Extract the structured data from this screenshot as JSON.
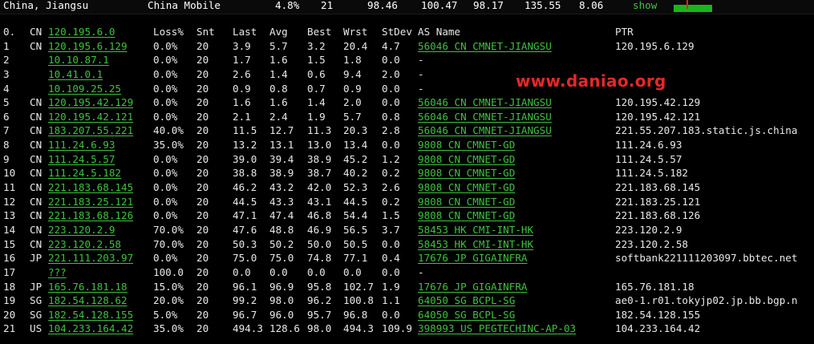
{
  "summary": {
    "location": "China, Jiangsu",
    "isp": "China Mobile",
    "loss": "4.8%",
    "snt": "21",
    "v1": "98.46",
    "v2": "100.47",
    "v3": "98.17",
    "v4": "135.55",
    "v5": "8.06",
    "show_label": "show"
  },
  "watermark": "www.daniao.org",
  "header": {
    "idx": "0.",
    "cc": "CN",
    "ip": "120.195.6.0",
    "loss": "Loss%",
    "snt": "Snt",
    "last": "Last",
    "avg": "Avg",
    "best": "Best",
    "wrst": "Wrst",
    "stdev": "StDev",
    "as": "AS Name",
    "ptr": "PTR"
  },
  "hops": [
    {
      "idx": "1",
      "cc": "CN",
      "ip": "120.195.6.129",
      "loss": "0.0%",
      "snt": "20",
      "last": "3.9",
      "avg": "5.7",
      "best": "3.2",
      "wrst": "20.4",
      "stdev": "4.7",
      "as": "56046 CN CMNET-JIANGSU",
      "ptr": "120.195.6.129"
    },
    {
      "idx": "2",
      "cc": "",
      "ip": "10.10.87.1",
      "loss": "0.0%",
      "snt": "20",
      "last": "1.7",
      "avg": "1.6",
      "best": "1.5",
      "wrst": "1.8",
      "stdev": "0.0",
      "as": "-",
      "ptr": ""
    },
    {
      "idx": "3",
      "cc": "",
      "ip": "10.41.0.1",
      "loss": "0.0%",
      "snt": "20",
      "last": "2.6",
      "avg": "1.4",
      "best": "0.6",
      "wrst": "9.4",
      "stdev": "2.0",
      "as": "-",
      "ptr": ""
    },
    {
      "idx": "4",
      "cc": "",
      "ip": "10.109.25.25",
      "loss": "0.0%",
      "snt": "20",
      "last": "0.9",
      "avg": "0.8",
      "best": "0.7",
      "wrst": "0.9",
      "stdev": "0.0",
      "as": "-",
      "ptr": ""
    },
    {
      "idx": "5",
      "cc": "CN",
      "ip": "120.195.42.129",
      "loss": "0.0%",
      "snt": "20",
      "last": "1.6",
      "avg": "1.6",
      "best": "1.4",
      "wrst": "2.0",
      "stdev": "0.0",
      "as": "56046 CN CMNET-JIANGSU",
      "ptr": "120.195.42.129"
    },
    {
      "idx": "6",
      "cc": "CN",
      "ip": "120.195.42.121",
      "loss": "0.0%",
      "snt": "20",
      "last": "2.1",
      "avg": "2.4",
      "best": "1.9",
      "wrst": "5.7",
      "stdev": "0.8",
      "as": "56046 CN CMNET-JIANGSU",
      "ptr": "120.195.42.121"
    },
    {
      "idx": "7",
      "cc": "CN",
      "ip": "183.207.55.221",
      "loss": "40.0%",
      "snt": "20",
      "last": "11.5",
      "avg": "12.7",
      "best": "11.3",
      "wrst": "20.3",
      "stdev": "2.8",
      "as": "56046 CN CMNET-JIANGSU",
      "ptr": "221.55.207.183.static.js.china"
    },
    {
      "idx": "8",
      "cc": "CN",
      "ip": "111.24.6.93",
      "loss": "35.0%",
      "snt": "20",
      "last": "13.2",
      "avg": "13.1",
      "best": "13.0",
      "wrst": "13.4",
      "stdev": "0.0",
      "as": "9808  CN CMNET-GD",
      "ptr": "111.24.6.93"
    },
    {
      "idx": "9",
      "cc": "CN",
      "ip": "111.24.5.57",
      "loss": "0.0%",
      "snt": "20",
      "last": "39.0",
      "avg": "39.4",
      "best": "38.9",
      "wrst": "45.2",
      "stdev": "1.2",
      "as": "9808  CN CMNET-GD",
      "ptr": "111.24.5.57"
    },
    {
      "idx": "10",
      "cc": "CN",
      "ip": "111.24.5.182",
      "loss": "0.0%",
      "snt": "20",
      "last": "38.8",
      "avg": "38.9",
      "best": "38.7",
      "wrst": "40.2",
      "stdev": "0.2",
      "as": "9808  CN CMNET-GD",
      "ptr": "111.24.5.182"
    },
    {
      "idx": "11",
      "cc": "CN",
      "ip": "221.183.68.145",
      "loss": "0.0%",
      "snt": "20",
      "last": "46.2",
      "avg": "43.2",
      "best": "42.0",
      "wrst": "52.3",
      "stdev": "2.6",
      "as": "9808  CN CMNET-GD",
      "ptr": "221.183.68.145"
    },
    {
      "idx": "12",
      "cc": "CN",
      "ip": "221.183.25.121",
      "loss": "0.0%",
      "snt": "20",
      "last": "44.5",
      "avg": "43.3",
      "best": "43.1",
      "wrst": "44.5",
      "stdev": "0.2",
      "as": "9808  CN CMNET-GD",
      "ptr": "221.183.25.121"
    },
    {
      "idx": "13",
      "cc": "CN",
      "ip": "221.183.68.126",
      "loss": "0.0%",
      "snt": "20",
      "last": "47.1",
      "avg": "47.4",
      "best": "46.8",
      "wrst": "54.4",
      "stdev": "1.5",
      "as": "9808  CN CMNET-GD",
      "ptr": "221.183.68.126"
    },
    {
      "idx": "14",
      "cc": "CN",
      "ip": "223.120.2.9",
      "loss": "70.0%",
      "snt": "20",
      "last": "47.6",
      "avg": "48.8",
      "best": "46.9",
      "wrst": "56.5",
      "stdev": "3.7",
      "as": "58453 HK CMI-INT-HK",
      "ptr": "223.120.2.9"
    },
    {
      "idx": "15",
      "cc": "CN",
      "ip": "223.120.2.58",
      "loss": "70.0%",
      "snt": "20",
      "last": "50.3",
      "avg": "50.2",
      "best": "50.0",
      "wrst": "50.5",
      "stdev": "0.0",
      "as": "58453 HK CMI-INT-HK",
      "ptr": "223.120.2.58"
    },
    {
      "idx": "16",
      "cc": "JP",
      "ip": "221.111.203.97",
      "loss": "0.0%",
      "snt": "20",
      "last": "75.0",
      "avg": "75.0",
      "best": "74.8",
      "wrst": "77.1",
      "stdev": "0.4",
      "as": "17676 JP GIGAINFRA",
      "ptr": "softbank221111203097.bbtec.net"
    },
    {
      "idx": "17",
      "cc": "",
      "ip": "???",
      "loss": "100.0",
      "snt": "20",
      "last": "0.0",
      "avg": "0.0",
      "best": "0.0",
      "wrst": "0.0",
      "stdev": "0.0",
      "as": "-",
      "ptr": ""
    },
    {
      "idx": "18",
      "cc": "JP",
      "ip": "165.76.181.18",
      "loss": "15.0%",
      "snt": "20",
      "last": "96.1",
      "avg": "96.9",
      "best": "95.8",
      "wrst": "102.7",
      "stdev": "1.9",
      "as": "17676 JP GIGAINFRA",
      "ptr": "165.76.181.18"
    },
    {
      "idx": "19",
      "cc": "SG",
      "ip": "182.54.128.62",
      "loss": "20.0%",
      "snt": "20",
      "last": "99.2",
      "avg": "98.0",
      "best": "96.2",
      "wrst": "100.8",
      "stdev": "1.1",
      "as": "64050 SG BCPL-SG",
      "ptr": "ae0-1.r01.tokyjp02.jp.bb.bgp.n"
    },
    {
      "idx": "20",
      "cc": "SG",
      "ip": "182.54.128.155",
      "loss": "5.0%",
      "snt": "20",
      "last": "96.7",
      "avg": "96.0",
      "best": "95.7",
      "wrst": "96.8",
      "stdev": "0.0",
      "as": "64050 SG BCPL-SG",
      "ptr": "182.54.128.155"
    },
    {
      "idx": "21",
      "cc": "US",
      "ip": "104.233.164.42",
      "loss": "35.0%",
      "snt": "20",
      "last": "494.3",
      "avg": "128.6",
      "best": "98.0",
      "wrst": "494.3",
      "stdev": "109.9",
      "as": "398993 US PEGTECHINC-AP-03",
      "ptr": "104.233.164.42"
    }
  ]
}
